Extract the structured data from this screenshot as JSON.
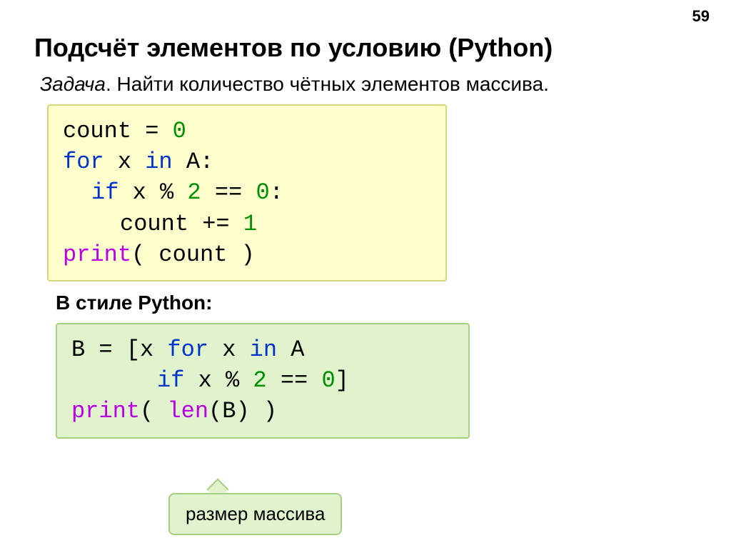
{
  "page_number": "59",
  "heading": "Подсчёт элементов по условию (Python)",
  "task": {
    "label": "Задача",
    "text": ". Найти количество чётных элементов массива."
  },
  "code1": {
    "l1": {
      "a": "count = ",
      "b": "0"
    },
    "l2": {
      "a": "for",
      "b": " x ",
      "c": "in",
      "d": " A:"
    },
    "l3": {
      "a": "if",
      "b": " x % ",
      "c": "2",
      "d": " == ",
      "e": "0",
      "f": ":"
    },
    "l4": {
      "a": "count += ",
      "b": "1"
    },
    "l5": {
      "a": "print",
      "b": "( count )"
    }
  },
  "subheading": "В стиле Python:",
  "code2": {
    "l1": {
      "a": "B = [x ",
      "b": "for",
      "c": " x ",
      "d": "in",
      "e": " A"
    },
    "l2": {
      "a": "if",
      "b": " x % ",
      "c": "2",
      "d": " == ",
      "e": "0",
      "f": "]"
    },
    "l3": {
      "a": "print",
      "b": "( ",
      "c": "len",
      "d": "(B) )"
    }
  },
  "callout": "размер массива"
}
